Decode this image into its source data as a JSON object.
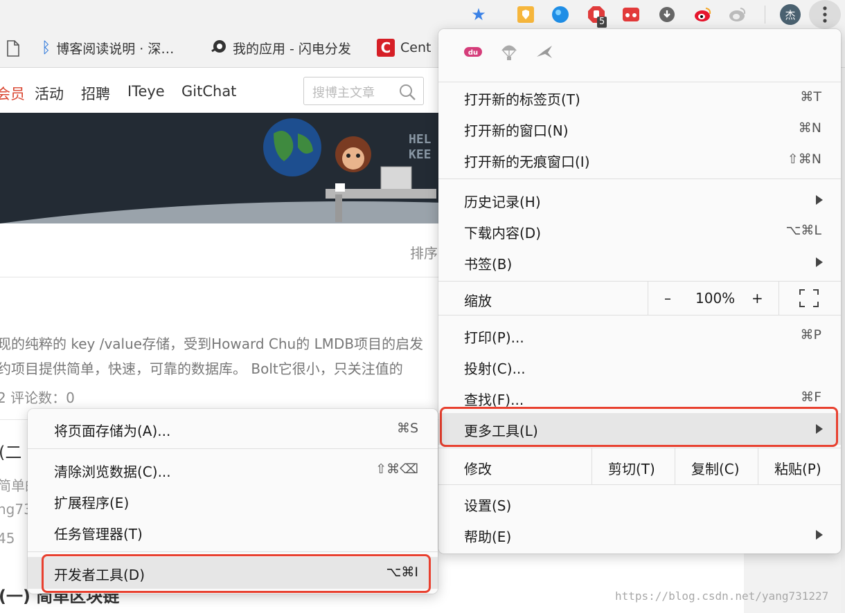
{
  "toolbar": {
    "extensions": [
      "star-icon",
      "shield-extension-icon",
      "globe-extension-icon",
      "adblock-extension-icon",
      "tab-extension-icon",
      "download-extension-icon",
      "weibo-extension-icon",
      "weibo-gray-extension-icon"
    ],
    "adblock_badge": "5",
    "profile_initial": "杰"
  },
  "bookmarks": [
    {
      "label": "博客阅读说明 · 深…",
      "icon": "bluetooth-icon"
    },
    {
      "label": "我的应用 - 闪电分发",
      "icon": "app-icon"
    },
    {
      "label": "Cent",
      "icon": "c-logo-icon"
    }
  ],
  "page": {
    "nav": [
      "会员",
      "活动",
      "招聘",
      "ITeye",
      "GitChat"
    ],
    "search_placeholder": "搜博主文章",
    "banner_text": [
      "HEL",
      "KEE"
    ],
    "sort_label": "排序",
    "article1_line1": "现的纯粹的 key /value存储，受到Howard Chu的 LMDB项目的启发",
    "article1_line2": "约项目提供简单，快速，可靠的数据库。 Bolt它很小，只关注值的",
    "article1_meta": "2    评论数：0",
    "article2_title": "(二",
    "article2_line1": "简单的",
    "article2_line2": "ng73",
    "article2_meta": "45",
    "article3_title": "(一)    简单区块链",
    "watermark": "https://blog.csdn.net/yang731227"
  },
  "main_menu": {
    "icons": [
      "du-icon",
      "parachute-icon",
      "bird-icon"
    ],
    "items": {
      "new_tab": {
        "label": "打开新的标签页(T)",
        "shortcut": "⌘T"
      },
      "new_window": {
        "label": "打开新的窗口(N)",
        "shortcut": "⌘N"
      },
      "incognito": {
        "label": "打开新的无痕窗口(I)",
        "shortcut": "⇧⌘N"
      },
      "history": {
        "label": "历史记录(H)"
      },
      "downloads": {
        "label": "下载内容(D)",
        "shortcut": "⌥⌘L"
      },
      "bookmarks": {
        "label": "书签(B)"
      },
      "zoom": {
        "label": "缩放",
        "minus": "–",
        "value": "100%",
        "plus": "+"
      },
      "print": {
        "label": "打印(P)...",
        "shortcut": "⌘P"
      },
      "cast": {
        "label": "投射(C)..."
      },
      "find": {
        "label": "查找(F)...",
        "shortcut": "⌘F"
      },
      "more_tools": {
        "label": "更多工具(L)"
      },
      "edit": {
        "label": "修改",
        "cut": "剪切(T)",
        "copy": "复制(C)",
        "paste": "粘贴(P)"
      },
      "settings": {
        "label": "设置(S)"
      },
      "help": {
        "label": "帮助(E)"
      }
    }
  },
  "sub_menu": {
    "save_page": {
      "label": "将页面存储为(A)...",
      "shortcut": "⌘S"
    },
    "clear_data": {
      "label": "清除浏览数据(C)...",
      "shortcut": "⇧⌘⌫"
    },
    "extensions": {
      "label": "扩展程序(E)"
    },
    "task_manager": {
      "label": "任务管理器(T)"
    },
    "devtools": {
      "label": "开发者工具(D)",
      "shortcut": "⌥⌘I"
    }
  },
  "colors": {
    "highlight_border": "#e8402f",
    "menu_bg": "#fafafa",
    "hover_bg": "#e6e6e6",
    "nav_accent": "#d9442f"
  }
}
